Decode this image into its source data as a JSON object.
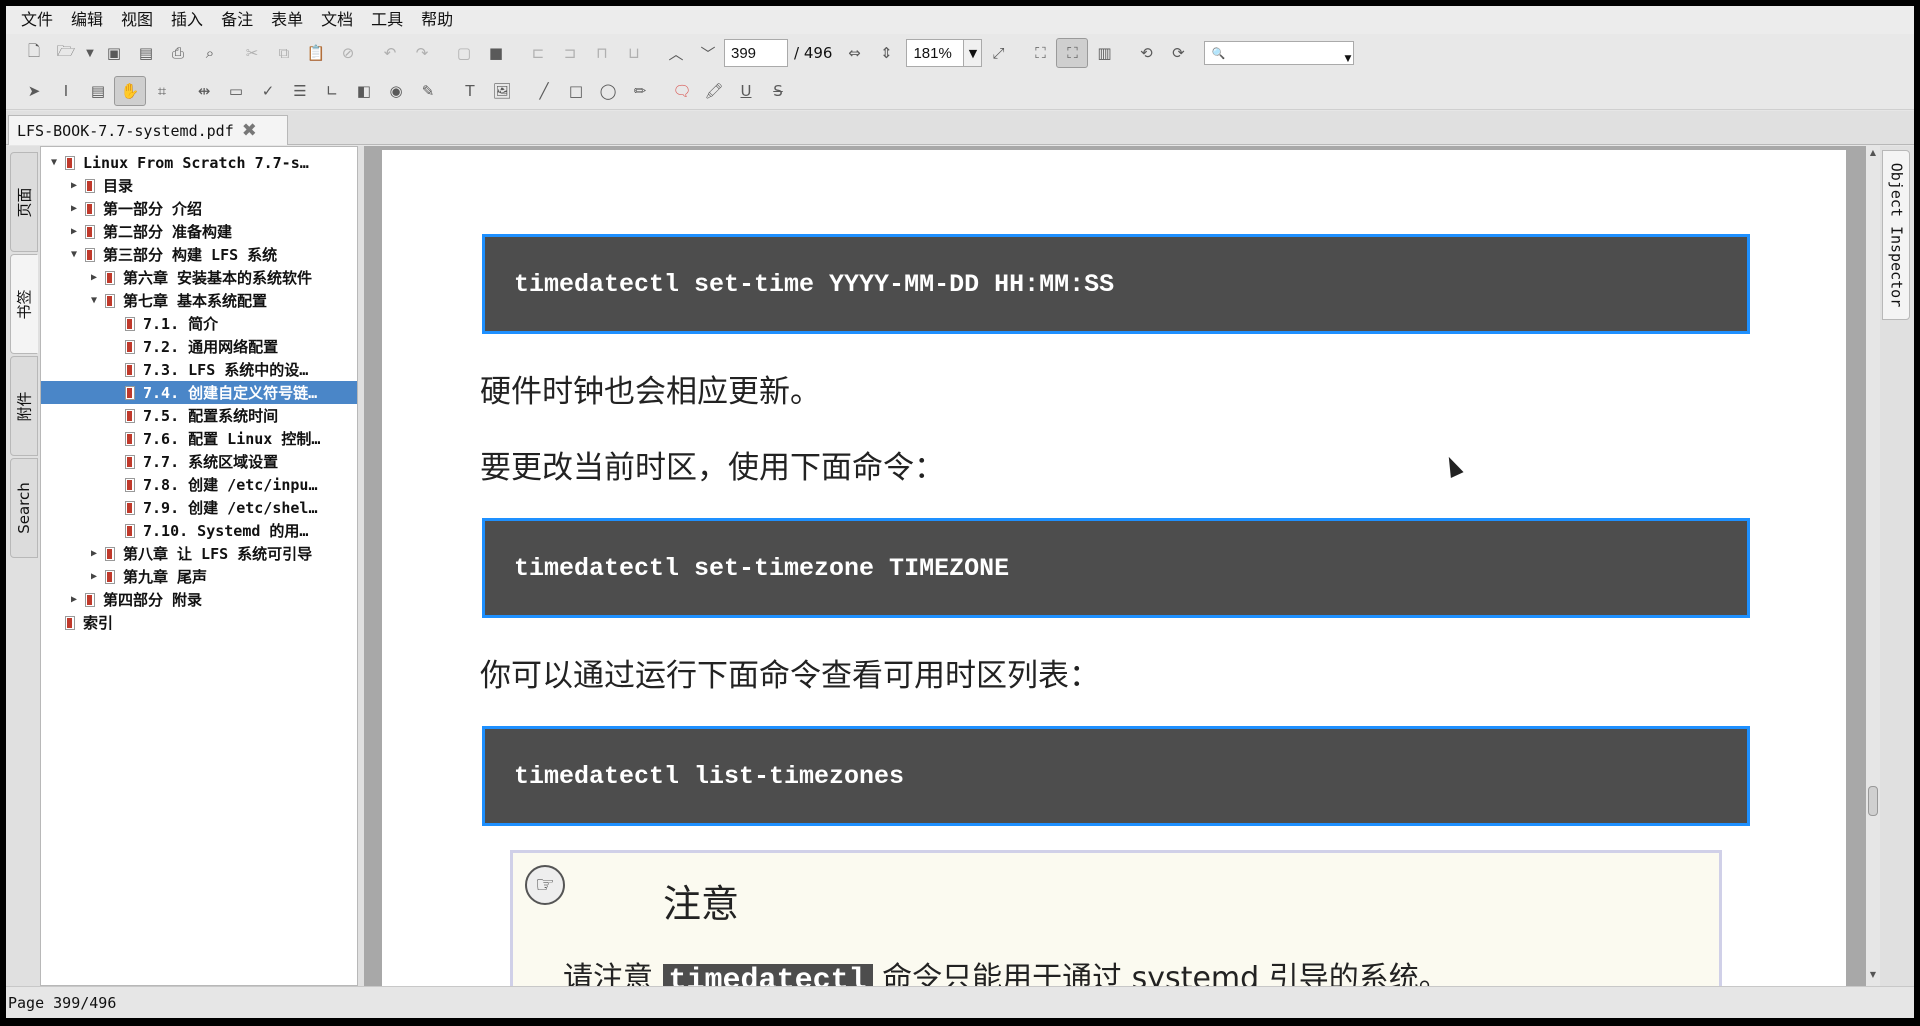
{
  "menu": [
    "文件",
    "编辑",
    "视图",
    "插入",
    "备注",
    "表单",
    "文档",
    "工具",
    "帮助"
  ],
  "toolbar": {
    "page_input": "399",
    "page_total": "/ 496",
    "zoom": "181%",
    "zoom_arrow": "▼",
    "search_placeholder": "",
    "search_icon": "🔍"
  },
  "icons": {
    "toolbar1": [
      "new-doc",
      "open",
      "open-arrow",
      "save",
      "save-as",
      "print",
      "print-preview",
      "cut",
      "copy",
      "paste",
      "delete",
      "undo",
      "redo",
      "fill-a",
      "fill-b",
      "align-left",
      "align-center",
      "align-right",
      "align-bottom",
      "prev-page",
      "next-page"
    ],
    "toolbar1_after": [
      "fit-width",
      "fit-height",
      "fullscreen",
      "zoom-fit",
      "zoom-page",
      "two-page",
      "rotate-left",
      "rotate-right"
    ],
    "toolbar2": [
      "select-arrow",
      "text-select",
      "form-field",
      "hand-tool",
      "crop",
      "link",
      "input-field",
      "checkmark",
      "list-box",
      "bracket",
      "page-box",
      "radio",
      "note",
      "text-t",
      "image",
      "line",
      "rectangle",
      "ellipse",
      "pencil",
      "comment",
      "highlight",
      "underline",
      "strikeout"
    ]
  },
  "doc_tab": {
    "title": "LFS-BOOK-7.7-systemd.pdf",
    "close": "✖"
  },
  "side_tabs": [
    "页面",
    "书签",
    "附件",
    "Search"
  ],
  "bookmarks": [
    {
      "label": "Linux From Scratch 7.7-s…",
      "level": 0,
      "arrow": "▼"
    },
    {
      "label": "目录",
      "level": 1,
      "arrow": "▶"
    },
    {
      "label": "第一部分 介绍",
      "level": 1,
      "arrow": "▶"
    },
    {
      "label": "第二部分 准备构建",
      "level": 1,
      "arrow": "▶"
    },
    {
      "label": "第三部分 构建 LFS 系统",
      "level": 1,
      "arrow": "▼"
    },
    {
      "label": "第六章 安装基本的系统软件",
      "level": 2,
      "arrow": "▶"
    },
    {
      "label": "第七章 基本系统配置",
      "level": 2,
      "arrow": "▼"
    },
    {
      "label": "7.1. 简介",
      "level": 3,
      "arrow": ""
    },
    {
      "label": "7.2. 通用网络配置",
      "level": 3,
      "arrow": ""
    },
    {
      "label": "7.3. LFS 系统中的设…",
      "level": 3,
      "arrow": ""
    },
    {
      "label": "7.4. 创建自定义符号链…",
      "level": 3,
      "arrow": "",
      "selected": true
    },
    {
      "label": "7.5. 配置系统时间",
      "level": 3,
      "arrow": ""
    },
    {
      "label": "7.6. 配置 Linux 控制…",
      "level": 3,
      "arrow": ""
    },
    {
      "label": "7.7. 系统区域设置",
      "level": 3,
      "arrow": ""
    },
    {
      "label": "7.8. 创建 /etc/inpu…",
      "level": 3,
      "arrow": ""
    },
    {
      "label": "7.9. 创建 /etc/shel…",
      "level": 3,
      "arrow": ""
    },
    {
      "label": "7.10. Systemd 的用…",
      "level": 3,
      "arrow": ""
    },
    {
      "label": "第八章 让 LFS 系统可引导",
      "level": 2,
      "arrow": "▶"
    },
    {
      "label": "第九章 尾声",
      "level": 2,
      "arrow": "▶"
    },
    {
      "label": "第四部分 附录",
      "level": 1,
      "arrow": "▶"
    },
    {
      "label": "索引",
      "level": 0,
      "arrow": ""
    }
  ],
  "document": {
    "code1": "timedatectl set-time YYYY-MM-DD HH:MM:SS",
    "para1": "硬件时钟也会相应更新。",
    "para2": "要更改当前时区，使用下面命令：",
    "code2": "timedatectl set-timezone TIMEZONE",
    "para3": "你可以通过运行下面命令查看可用时区列表：",
    "code3": "timedatectl list-timezones",
    "note_title": "注意",
    "note_prefix": "请注意",
    "note_code": "timedatectl",
    "note_suffix": "命令只能用于通过 systemd 引导的系统。"
  },
  "right_tab": "Object Inspector",
  "status": "Page 399/496",
  "colors": {
    "code_bg": "#4d4d4d",
    "code_border": "#1e90ff",
    "selection": "#4a86c8",
    "note_bg": "#fbfaf0"
  }
}
